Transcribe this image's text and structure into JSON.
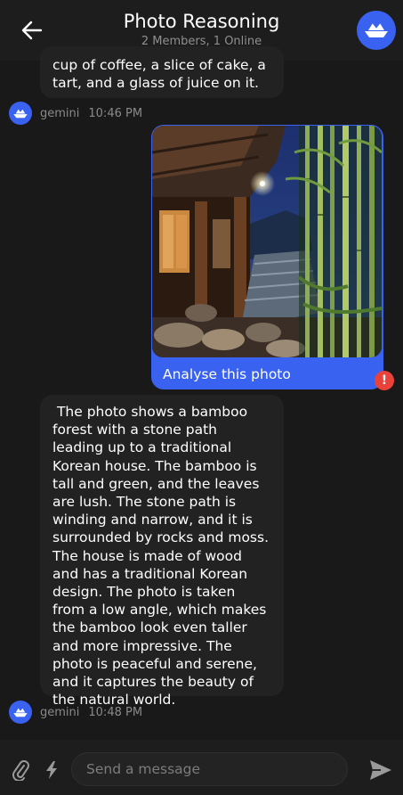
{
  "header": {
    "title": "Photo Reasoning",
    "subtitle": "2 Members, 1 Online"
  },
  "messages": [
    {
      "type": "bot",
      "text": "cup of coffee, a slice of cake, a tart, and a glass of juice on it.",
      "sender": "gemini",
      "time": "10:46 PM"
    },
    {
      "type": "user",
      "caption": "Analyse this photo",
      "status": "error",
      "image": "bamboo-forest-stone-path-korean-house"
    },
    {
      "type": "bot",
      "text": " The photo shows a bamboo forest with a stone path leading up to a traditional Korean house. The bamboo is tall and green, and the leaves are lush. The stone path is winding and narrow, and it is surrounded by rocks and moss. The house is made of wood and has a traditional Korean design. The photo is taken from a low angle, which makes the bamboo look even taller and more impressive. The photo is peaceful and serene, and it captures the beauty of the natural world.",
      "sender": "gemini",
      "time": "10:48 PM"
    }
  ],
  "composer": {
    "placeholder": "Send a message"
  },
  "colors": {
    "accent": "#3a62f0",
    "background": "#191919",
    "bubble": "#222222",
    "error": "#e9423a"
  },
  "icons": [
    "back-arrow-icon",
    "paper-boat-icon",
    "error-icon",
    "paperclip-icon",
    "lightning-icon",
    "send-icon"
  ]
}
